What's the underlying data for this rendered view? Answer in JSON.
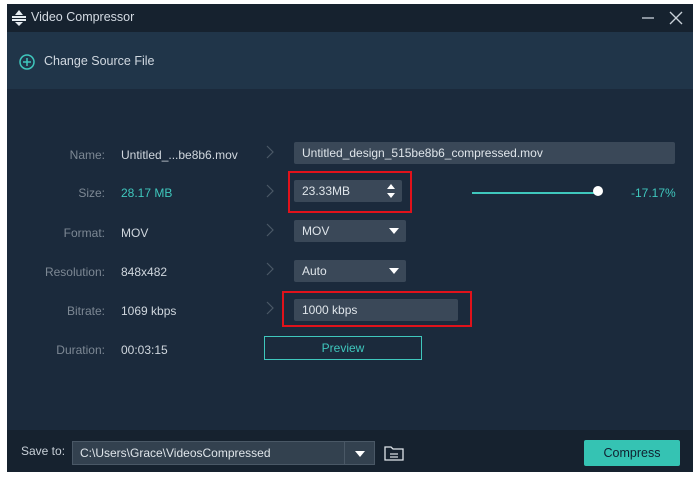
{
  "window": {
    "title": "Video Compressor"
  },
  "source": {
    "change_label": "Change Source File"
  },
  "fields": {
    "name": {
      "label": "Name:",
      "value": "Untitled_...be8b6.mov",
      "output": "Untitled_design_515be8b6_compressed.mov"
    },
    "size": {
      "label": "Size:",
      "value": "28.17 MB",
      "output": "23.33MB",
      "percent": "-17.17%",
      "slider_level": 0.93
    },
    "format": {
      "label": "Format:",
      "value": "MOV",
      "output": "MOV"
    },
    "resolution": {
      "label": "Resolution:",
      "value": "848x482",
      "output": "Auto"
    },
    "bitrate": {
      "label": "Bitrate:",
      "value": "1069 kbps",
      "output": "1000 kbps"
    },
    "duration": {
      "label": "Duration:",
      "value": "00:03:15"
    }
  },
  "preview_label": "Preview",
  "footer": {
    "save_label": "Save to:",
    "path": "C:\\Users\\Grace\\VideosCompressed",
    "compress_label": "Compress"
  },
  "colors": {
    "accent": "#3fc7bd",
    "highlight": "#e0121b",
    "background": "#1b2a3c"
  },
  "icons": [
    "app-icon",
    "minimize-icon",
    "close-icon",
    "plus-circle-icon",
    "chevron-right-icon",
    "dropdown-arrow-icon",
    "spinner-up-icon",
    "spinner-down-icon",
    "folder-icon"
  ]
}
